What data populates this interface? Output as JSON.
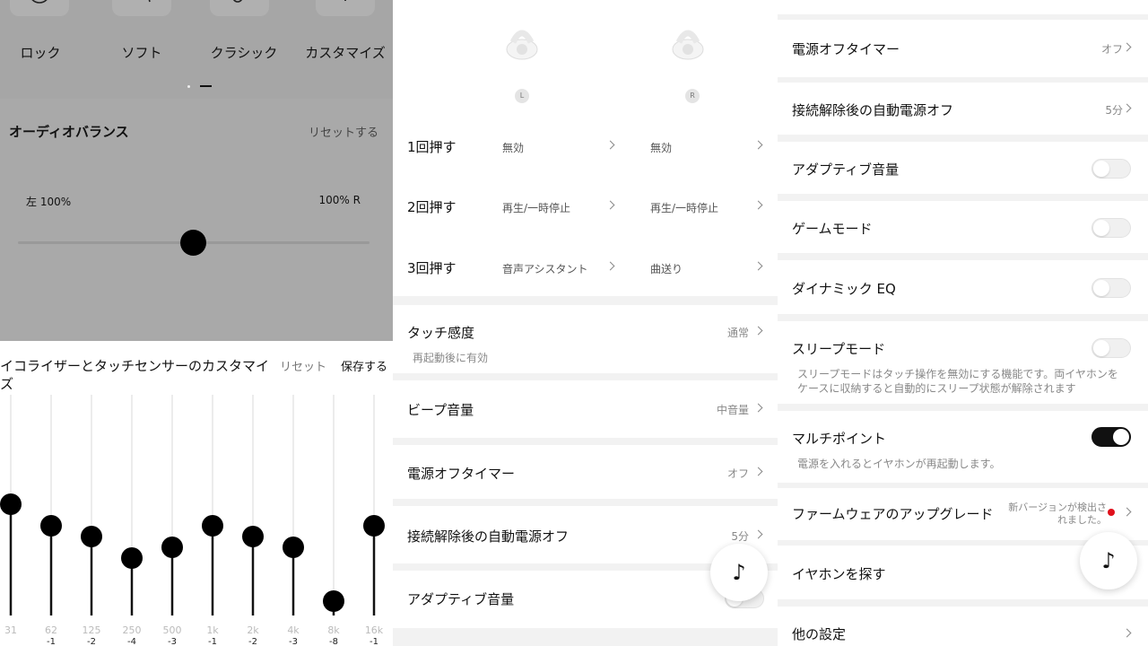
{
  "equalizer_panel": {
    "presets": [
      "ロック",
      "ソフト",
      "クラシック",
      "カスタマイズ"
    ],
    "audio_balance": {
      "title": "オーディオバランス",
      "reset_label": "リセットする",
      "left_label": "左 100%",
      "right_label": "100% R",
      "balance_position": 0.5
    },
    "eq": {
      "title": "イコライザーとタッチセンサーのカスタマイズ",
      "reset_label": "リセット",
      "save_label": "保存する",
      "bands": [
        {
          "freq": "31",
          "gain": "",
          "value": 1
        },
        {
          "freq": "62",
          "gain": "-1",
          "value": -1
        },
        {
          "freq": "125",
          "gain": "-2",
          "value": -2
        },
        {
          "freq": "250",
          "gain": "-4",
          "value": -4
        },
        {
          "freq": "500",
          "gain": "-3",
          "value": -3
        },
        {
          "freq": "1k",
          "gain": "-1",
          "value": -1
        },
        {
          "freq": "2k",
          "gain": "-2",
          "value": -2
        },
        {
          "freq": "4k",
          "gain": "-3",
          "value": -3
        },
        {
          "freq": "8k",
          "gain": "-8",
          "value": -8
        },
        {
          "freq": "16k",
          "gain": "-1",
          "value": -1
        }
      ]
    }
  },
  "touch_panel": {
    "left_badge": "L",
    "right_badge": "R",
    "press_rows": [
      {
        "label": "1回押す",
        "left": "無効",
        "right": "無効"
      },
      {
        "label": "2回押す",
        "left": "再生/一時停止",
        "right": "再生/一時停止"
      },
      {
        "label": "3回押す",
        "left": "音声アシスタント",
        "right": "曲送り"
      }
    ],
    "touch_sensitivity": {
      "label": "タッチ感度",
      "value": "通常",
      "note": "再起動後に有効"
    },
    "beep_volume": {
      "label": "ビープ音量",
      "value": "中音量"
    },
    "power_off_timer": {
      "label": "電源オフタイマー",
      "value": "オフ"
    },
    "auto_power_off": {
      "label": "接続解除後の自動電源オフ",
      "value": "5分"
    },
    "adaptive_volume": {
      "label": "アダプティブ音量"
    }
  },
  "settings_panel": {
    "power_off_timer": {
      "label": "電源オフタイマー",
      "value": "オフ"
    },
    "auto_power_off": {
      "label": "接続解除後の自動電源オフ",
      "value": "5分"
    },
    "adaptive_volume": {
      "label": "アダプティブ音量",
      "enabled": false
    },
    "game_mode": {
      "label": "ゲームモード",
      "enabled": false
    },
    "dynamic_eq": {
      "label": "ダイナミック EQ",
      "enabled": false
    },
    "sleep_mode": {
      "label": "スリープモード",
      "enabled": false,
      "note_line1": "スリープモードはタッチ操作を無効にする機能です。両イヤホンを",
      "note_line2": "ケースに収納すると自動的にスリープ状態が解除されます"
    },
    "multipoint": {
      "label": "マルチポイント",
      "enabled": true,
      "note": "電源を入れるとイヤホンが再起動します。"
    },
    "firmware": {
      "label": "ファームウェアのアップグレード",
      "status_line1": "新バージョンが検出さ",
      "status_line2": "れました。"
    },
    "find_earbuds": {
      "label": "イヤホンを探す"
    },
    "other_settings": {
      "label": "他の設定"
    }
  },
  "colors": {
    "accent": "#111111",
    "notification": "#e0101b"
  },
  "icons": [
    "rock-preset-icon",
    "soft-preset-icon",
    "guitar-icon",
    "plus-icon",
    "music-note-icon",
    "chevron-right-icon",
    "earbud-icon"
  ]
}
